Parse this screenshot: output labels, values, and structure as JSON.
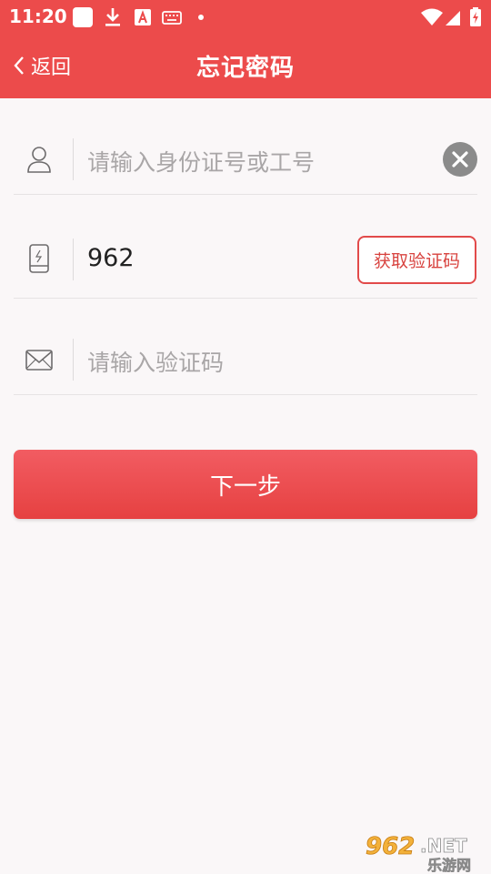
{
  "status_bar": {
    "time": "11:20",
    "icons": [
      "app-square-icon",
      "download-icon",
      "text-a-icon",
      "keyboard-icon",
      "dot-icon",
      "wifi-icon",
      "signal-icon",
      "battery-charging-icon"
    ]
  },
  "header": {
    "back_label": "返回",
    "title": "忘记密码"
  },
  "form": {
    "id_field": {
      "placeholder": "请输入身份证号或工号",
      "value": "",
      "icon": "user-icon"
    },
    "phone_field": {
      "value": "962",
      "icon": "phone-icon"
    },
    "get_code_label": "获取验证码",
    "code_field": {
      "placeholder": "请输入验证码",
      "value": "",
      "icon": "envelope-icon"
    }
  },
  "next_button_label": "下一步",
  "watermark": {
    "brand": "962",
    "suffix": ".NET",
    "tagline": "乐游网"
  },
  "colors": {
    "primary": "#ec4b4b",
    "button_top": "#f25c62",
    "button_bottom": "#e64141",
    "background": "#faf7f8"
  }
}
